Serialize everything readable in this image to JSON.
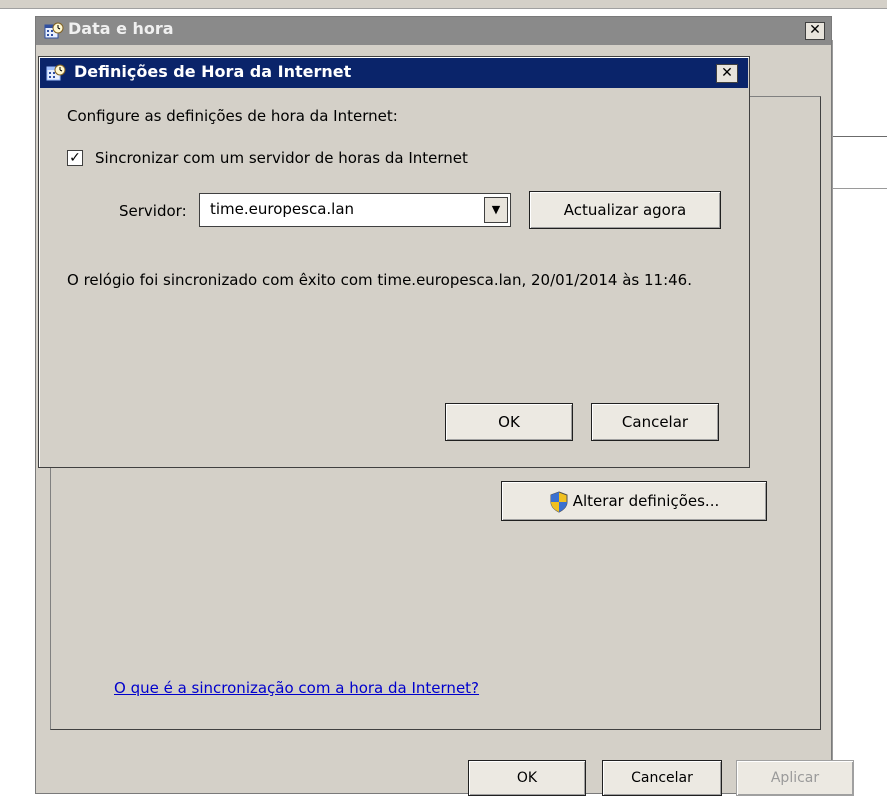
{
  "outer_window": {
    "title": "Data e hora",
    "close_glyph": "✕",
    "alter_settings_label": "Alterar definições...",
    "help_link": "O que é a sincronização com a hora da Internet?",
    "ok_label": "OK",
    "cancel_label": "Cancelar",
    "apply_label": "Aplicar"
  },
  "inner_dialog": {
    "title": "Definições de Hora da Internet",
    "close_glyph": "✕",
    "configure_text": "Configure as definições de hora da Internet:",
    "sync_checkbox": {
      "label": "Sincronizar com um servidor de horas da Internet",
      "checked": true,
      "mark": "✓"
    },
    "server_label": "Servidor:",
    "server_value": "time.europesca.lan",
    "dropdown_glyph": "▼",
    "update_button": "Actualizar agora",
    "status_text": "O relógio foi sincronizado com êxito com time.europesca.lan, 20/01/2014 às 11:46.",
    "ok_label": "OK",
    "cancel_label": "Cancelar"
  },
  "icons": {
    "window_icon": "date-time-icon",
    "shield_icon": "uac-shield-icon"
  },
  "colors": {
    "active_title": "#0a246a",
    "inactive_title": "#8a8a8a",
    "dialog_face": "#d4d0c8",
    "link": "#0000cc"
  }
}
